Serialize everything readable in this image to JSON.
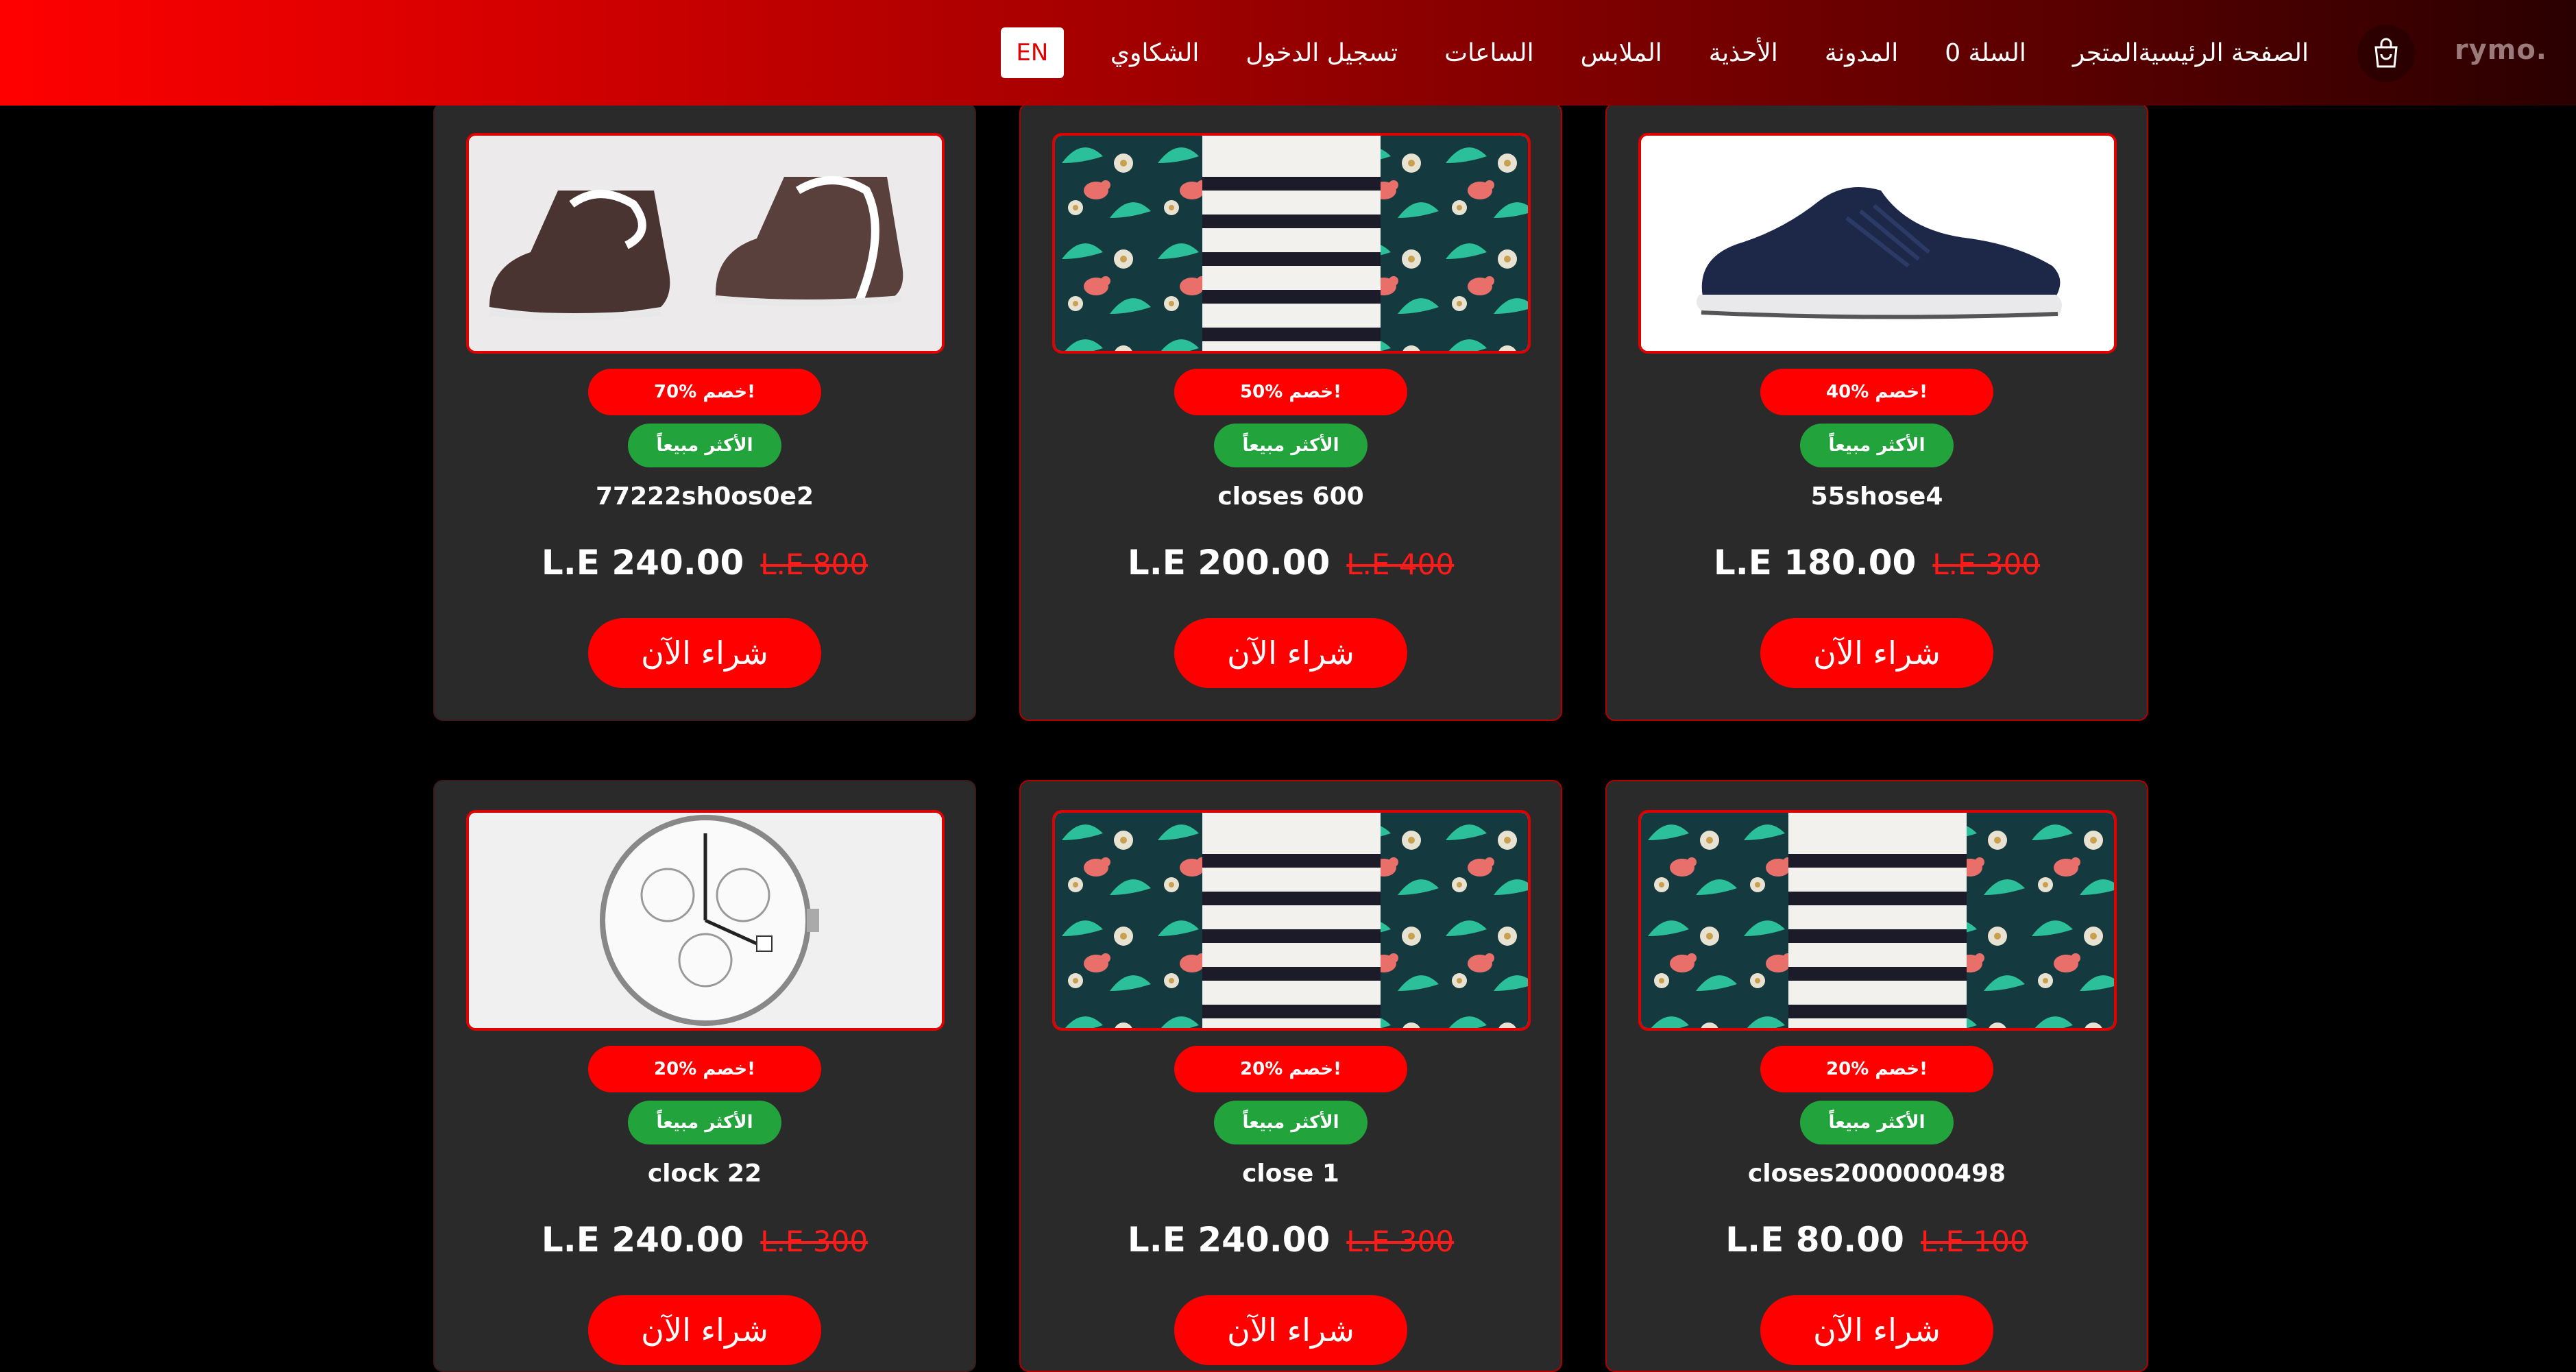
{
  "nav": {
    "logo_text": "rymo.",
    "links": [
      "الصفحة الرئيسية",
      "المتجر",
      "السلة 0",
      "المدونة",
      "الأحذية",
      "الملابس",
      "الساعات",
      "تسجيل الدخول",
      "الشكاوي"
    ],
    "lang": "EN"
  },
  "buy_label": "شراء الآن",
  "best_label": "الأكثر مبيعاً",
  "products": [
    {
      "name": "55shose4",
      "discount": "40% خصم!",
      "price": "L.E 180.00",
      "old_price": "L.E 300",
      "image": "sneaker"
    },
    {
      "name": "closes 600",
      "discount": "50% خصم!",
      "price": "L.E 200.00",
      "old_price": "L.E 400",
      "image": "pattern-dress"
    },
    {
      "name": "77222sh0os0e2",
      "discount": "70% خصم!",
      "price": "L.E 240.00",
      "old_price": "L.E 800",
      "image": "leather-boots"
    },
    {
      "name": "closes2000000498",
      "discount": "20% خصم!",
      "price": "L.E 80.00",
      "old_price": "L.E 100",
      "image": "pattern-dress"
    },
    {
      "name": "close 1",
      "discount": "20% خصم!",
      "price": "L.E 240.00",
      "old_price": "L.E 300",
      "image": "pattern-dress"
    },
    {
      "name": "clock 22",
      "discount": "20% خصم!",
      "price": "L.E 240.00",
      "old_price": "L.E 300",
      "image": "wrist-watch"
    }
  ],
  "colors": {
    "accent": "#ff0000",
    "best_badge": "#22a33c",
    "card_bg": "#2a2a2a"
  }
}
